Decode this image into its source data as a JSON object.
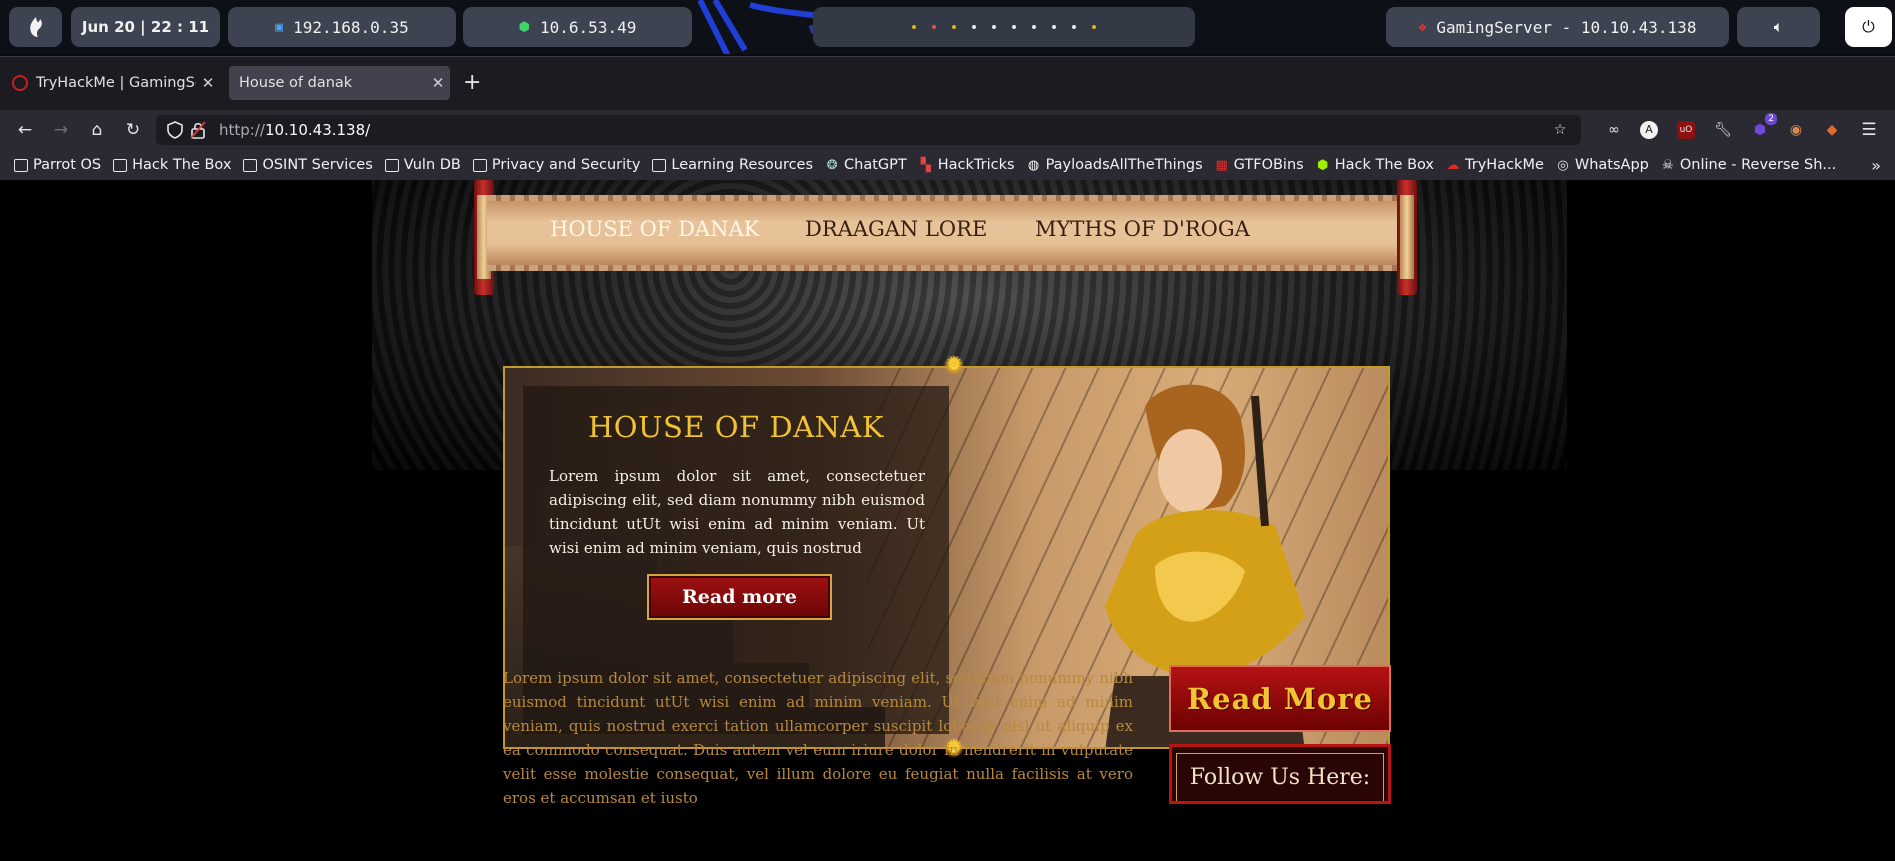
{
  "panel": {
    "clock": "Jun 20  |  22 : 11",
    "ip_local": "192.168.0.35",
    "ip_vpn": "10.6.53.49",
    "target": "GamingServer - 10.10.43.138"
  },
  "tabs": [
    {
      "label": "TryHackMe | GamingServer"
    },
    {
      "label": "House of danak"
    }
  ],
  "url": {
    "protocol": "http://",
    "host": "10.10.43.138/"
  },
  "bookmarks": [
    {
      "label": "Parrot OS",
      "icon": "folder-icon"
    },
    {
      "label": "Hack The Box",
      "icon": "folder-icon"
    },
    {
      "label": "OSINT Services",
      "icon": "folder-icon"
    },
    {
      "label": "Vuln DB",
      "icon": "folder-icon"
    },
    {
      "label": "Privacy and Security",
      "icon": "folder-icon"
    },
    {
      "label": "Learning Resources",
      "icon": "folder-icon"
    },
    {
      "label": "ChatGPT",
      "icon": "chatgpt-icon"
    },
    {
      "label": "HackTricks",
      "icon": "hacktricks-icon"
    },
    {
      "label": "PayloadsAllTheThings",
      "icon": "github-icon"
    },
    {
      "label": "GTFOBins",
      "icon": "gtfobins-icon"
    },
    {
      "label": "Hack The Box",
      "icon": "htb-icon"
    },
    {
      "label": "TryHackMe",
      "icon": "thm-icon"
    },
    {
      "label": "WhatsApp",
      "icon": "globe-icon"
    },
    {
      "label": "Online - Reverse Sh...",
      "icon": "skull-icon"
    }
  ],
  "extension_badge": "2",
  "site": {
    "nav": [
      "HOUSE OF DANAK",
      "DRAAGAN LORE",
      "MYTHS OF D'ROGA"
    ],
    "hero": {
      "title": "HOUSE OF DANAK",
      "text": "Lorem ipsum dolor sit amet, consectetuer adipiscing elit, sed diam nonummy nibh euismod tincidunt utUt wisi enim ad minim veniam. Ut wisi enim ad minim veniam, quis nostrud",
      "button": "Read more"
    },
    "body_text": "Lorem ipsum dolor sit amet, consectetuer adipiscing elit, sed diam nonummy nibh euismod tincidunt utUt wisi enim ad minim veniam. Ut wisi enim ad minim veniam, quis nostrud exerci tation ullamcorper suscipit lobortis nisl ut aliquip ex ea commodo consequat. Duis autem vel eum iriure dolor in hendrerit in vulputate velit esse molestie consequat, vel illum dolore eu feugiat nulla facilisis at vero eros et accumsan et iusto",
    "sidebar_button": "Read More",
    "follow_label": "Follow Us Here:"
  },
  "colors": {
    "accent_gold": "#f1c232",
    "crimson": "#9e1111",
    "body_text": "#b8893d"
  }
}
